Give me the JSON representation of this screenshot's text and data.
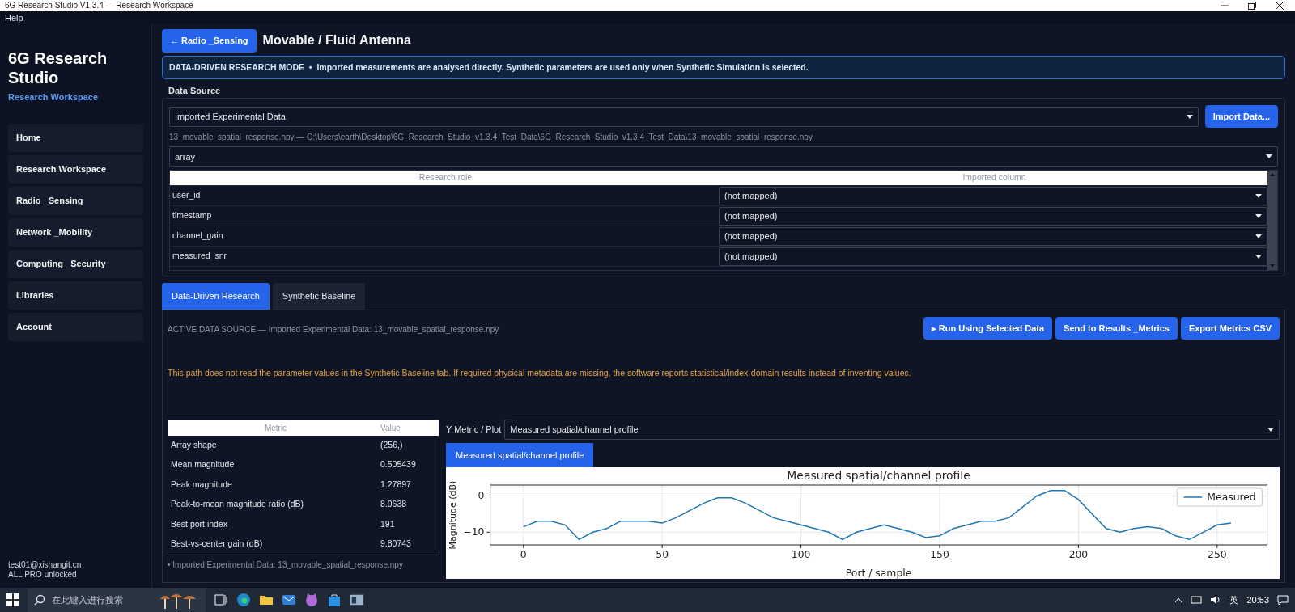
{
  "window": {
    "title": "6G Research Studio V1.3.4 — Research Workspace"
  },
  "menu": [
    {
      "label": "Help"
    }
  ],
  "sidebar": {
    "title": "6G Research Studio",
    "subtitle": "Research Workspace",
    "items": [
      {
        "label": "Home"
      },
      {
        "label": "Research Workspace"
      },
      {
        "label": "Radio _Sensing"
      },
      {
        "label": "Network _Mobility"
      },
      {
        "label": "Computing _Security"
      },
      {
        "label": "Libraries"
      },
      {
        "label": "Account"
      }
    ],
    "user": "test01@xishangit.cn",
    "license": "ALL PRO unlocked"
  },
  "header": {
    "back_button": "← Radio _Sensing",
    "title": "Movable / Fluid Antenna"
  },
  "banner": "DATA-DRIVEN RESEARCH MODE  •  Imported measurements are analysed directly. Synthetic parameters are used only when Synthetic Simulation is selected.",
  "data_source": {
    "label": "Data Source",
    "source_select": "Imported Experimental Data",
    "import_button": "Import Data...",
    "path": "13_movable_spatial_response.npy — C:\\Users\\earth\\Desktop\\6G_Research_Studio_v1.3.4_Test_Data\\6G_Research_Studio_v1.3.4_Test_Data\\13_movable_spatial_response.npy",
    "array_select": "array",
    "mapping": {
      "columns": [
        "Research role",
        "Imported column"
      ],
      "rows": [
        {
          "role": "user_id",
          "column": "(not mapped)"
        },
        {
          "role": "timestamp",
          "column": "(not mapped)"
        },
        {
          "role": "channel_gain",
          "column": "(not mapped)"
        },
        {
          "role": "measured_snr",
          "column": "(not mapped)"
        }
      ]
    }
  },
  "tabs": [
    {
      "label": "Data-Driven Research",
      "selected": true
    },
    {
      "label": "Synthetic Baseline",
      "selected": false
    }
  ],
  "panel": {
    "active_source": "ACTIVE DATA SOURCE — Imported Experimental Data: 13_movable_spatial_response.npy",
    "buttons": [
      "▸ Run Using Selected Data",
      "Send to Results _Metrics",
      "Export Metrics CSV"
    ],
    "note": "This path does not read the parameter values in the Synthetic Baseline tab. If required physical metadata are missing, the software reports statistical/index-domain results instead of inventing values.",
    "metrics": {
      "columns": [
        "Metric",
        "Value"
      ],
      "rows": [
        {
          "metric": "Array shape",
          "value": "(256,)"
        },
        {
          "metric": "Mean magnitude",
          "value": "0.505439"
        },
        {
          "metric": "Peak magnitude",
          "value": "1.27897"
        },
        {
          "metric": "Peak-to-mean magnitude ratio (dB)",
          "value": "8.0638"
        },
        {
          "metric": "Best port index",
          "value": "191"
        },
        {
          "metric": "Best-vs-center gain (dB)",
          "value": "9.80743"
        }
      ]
    },
    "footnote": "• Imported Experimental Data: 13_movable_spatial_response.npy",
    "y_metric_label": "Y Metric / Plot",
    "y_metric_select": "Measured spatial/channel profile",
    "plot_tabs": [
      {
        "label": "Measured spatial/channel profile",
        "selected": true
      }
    ],
    "chart_data": {
      "type": "line",
      "title": "Measured spatial/channel profile",
      "xlabel": "Port / sample",
      "ylabel": "Magnitude (dB)",
      "x": [
        0,
        5,
        10,
        15,
        20,
        25,
        30,
        35,
        40,
        45,
        50,
        55,
        60,
        65,
        70,
        75,
        80,
        85,
        90,
        95,
        100,
        105,
        110,
        115,
        120,
        125,
        130,
        135,
        140,
        145,
        150,
        155,
        160,
        165,
        170,
        175,
        180,
        185,
        190,
        195,
        200,
        205,
        210,
        215,
        220,
        225,
        230,
        235,
        240,
        245,
        250,
        255
      ],
      "series": [
        {
          "name": "Measured",
          "color": "#1f77b4",
          "values": [
            -8.5,
            -7,
            -7,
            -8,
            -12,
            -10,
            -9,
            -7,
            -7,
            -7,
            -7.5,
            -6,
            -4,
            -2,
            -0.5,
            -0.5,
            -2,
            -4,
            -6,
            -7,
            -8,
            -9,
            -10,
            -12,
            -10,
            -9,
            -8,
            -9,
            -10,
            -11.5,
            -11,
            -9,
            -8,
            -7,
            -7,
            -6,
            -3,
            0,
            1.5,
            1.5,
            -1,
            -5,
            -9,
            -10,
            -9,
            -8.5,
            -9,
            -11,
            -12,
            -10,
            -8,
            -7.5
          ]
        }
      ],
      "grid": true,
      "xlim": [
        -12,
        268
      ],
      "ylim": [
        -13.5,
        3
      ],
      "xticks": [
        0,
        50,
        100,
        150,
        200,
        250
      ],
      "yticks": [
        {
          "value": 0,
          "label": "0"
        },
        {
          "value": -10,
          "label": "−10"
        }
      ]
    }
  },
  "taskbar": {
    "search_placeholder": "在此键入进行搜索",
    "ime": "英",
    "time": "20:53"
  }
}
